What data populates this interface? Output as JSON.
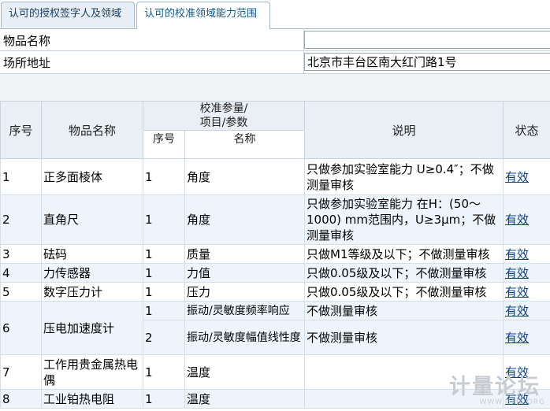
{
  "tabs": [
    {
      "label": "认可的授权签字人及领域"
    },
    {
      "label": "认可的校准领域能力范围"
    }
  ],
  "form": {
    "item_name_label": "物品名称",
    "item_name_value": "",
    "location_label": "场所地址",
    "location_value": "北京市丰台区南大红门路1号"
  },
  "table": {
    "headers": {
      "seq": "序号",
      "item_name": "物品名称",
      "param_group": "校准参量/\n项目/参数",
      "sub_seq": "序号",
      "sub_name": "名称",
      "note": "说明",
      "status": "状态"
    },
    "rows": [
      {
        "seq": "1",
        "item": "正多面棱体",
        "sub_seq": "1",
        "param": "角度",
        "note": "只做参加实验室能力 U≥0.4″；不做测量审核",
        "status": "有效"
      },
      {
        "seq": "2",
        "item": "直角尺",
        "sub_seq": "1",
        "param": "角度",
        "note": "只做参加实验室能力 在H：(50～1000) mm范围内，U≥3μm；不做测量审核",
        "status": "有效"
      },
      {
        "seq": "3",
        "item": "砝码",
        "sub_seq": "1",
        "param": "质量",
        "note": "只做M1等级及以下；不做测量审核",
        "status": "有效"
      },
      {
        "seq": "4",
        "item": "力传感器",
        "sub_seq": "1",
        "param": "力值",
        "note": "只做0.05级及以下；不做测量审核",
        "status": "有效"
      },
      {
        "seq": "5",
        "item": "数字压力计",
        "sub_seq": "1",
        "param": "压力",
        "note": "只做0.05级及以下；不做测量审核",
        "status": "有效"
      },
      {
        "seq": "6",
        "item": "压电加速度计",
        "subs": [
          {
            "sub_seq": "1",
            "param": "振动/灵敏度频率响应",
            "note": "不做测量审核",
            "status": "有效"
          },
          {
            "sub_seq": "2",
            "param": "振动/灵敏度幅值线性度",
            "note": "不做测量审核",
            "status": "有效"
          }
        ]
      },
      {
        "seq": "7",
        "item": "工作用贵金属热电偶",
        "sub_seq": "1",
        "param": "温度",
        "note": "",
        "status": "有效"
      },
      {
        "seq": "8",
        "item": "工业铂热电阻",
        "sub_seq": "1",
        "param": "温度",
        "note": "",
        "status": "有效"
      }
    ]
  },
  "watermark": {
    "text": "计量论坛",
    "url": "WWW.GFJL.ORG"
  }
}
